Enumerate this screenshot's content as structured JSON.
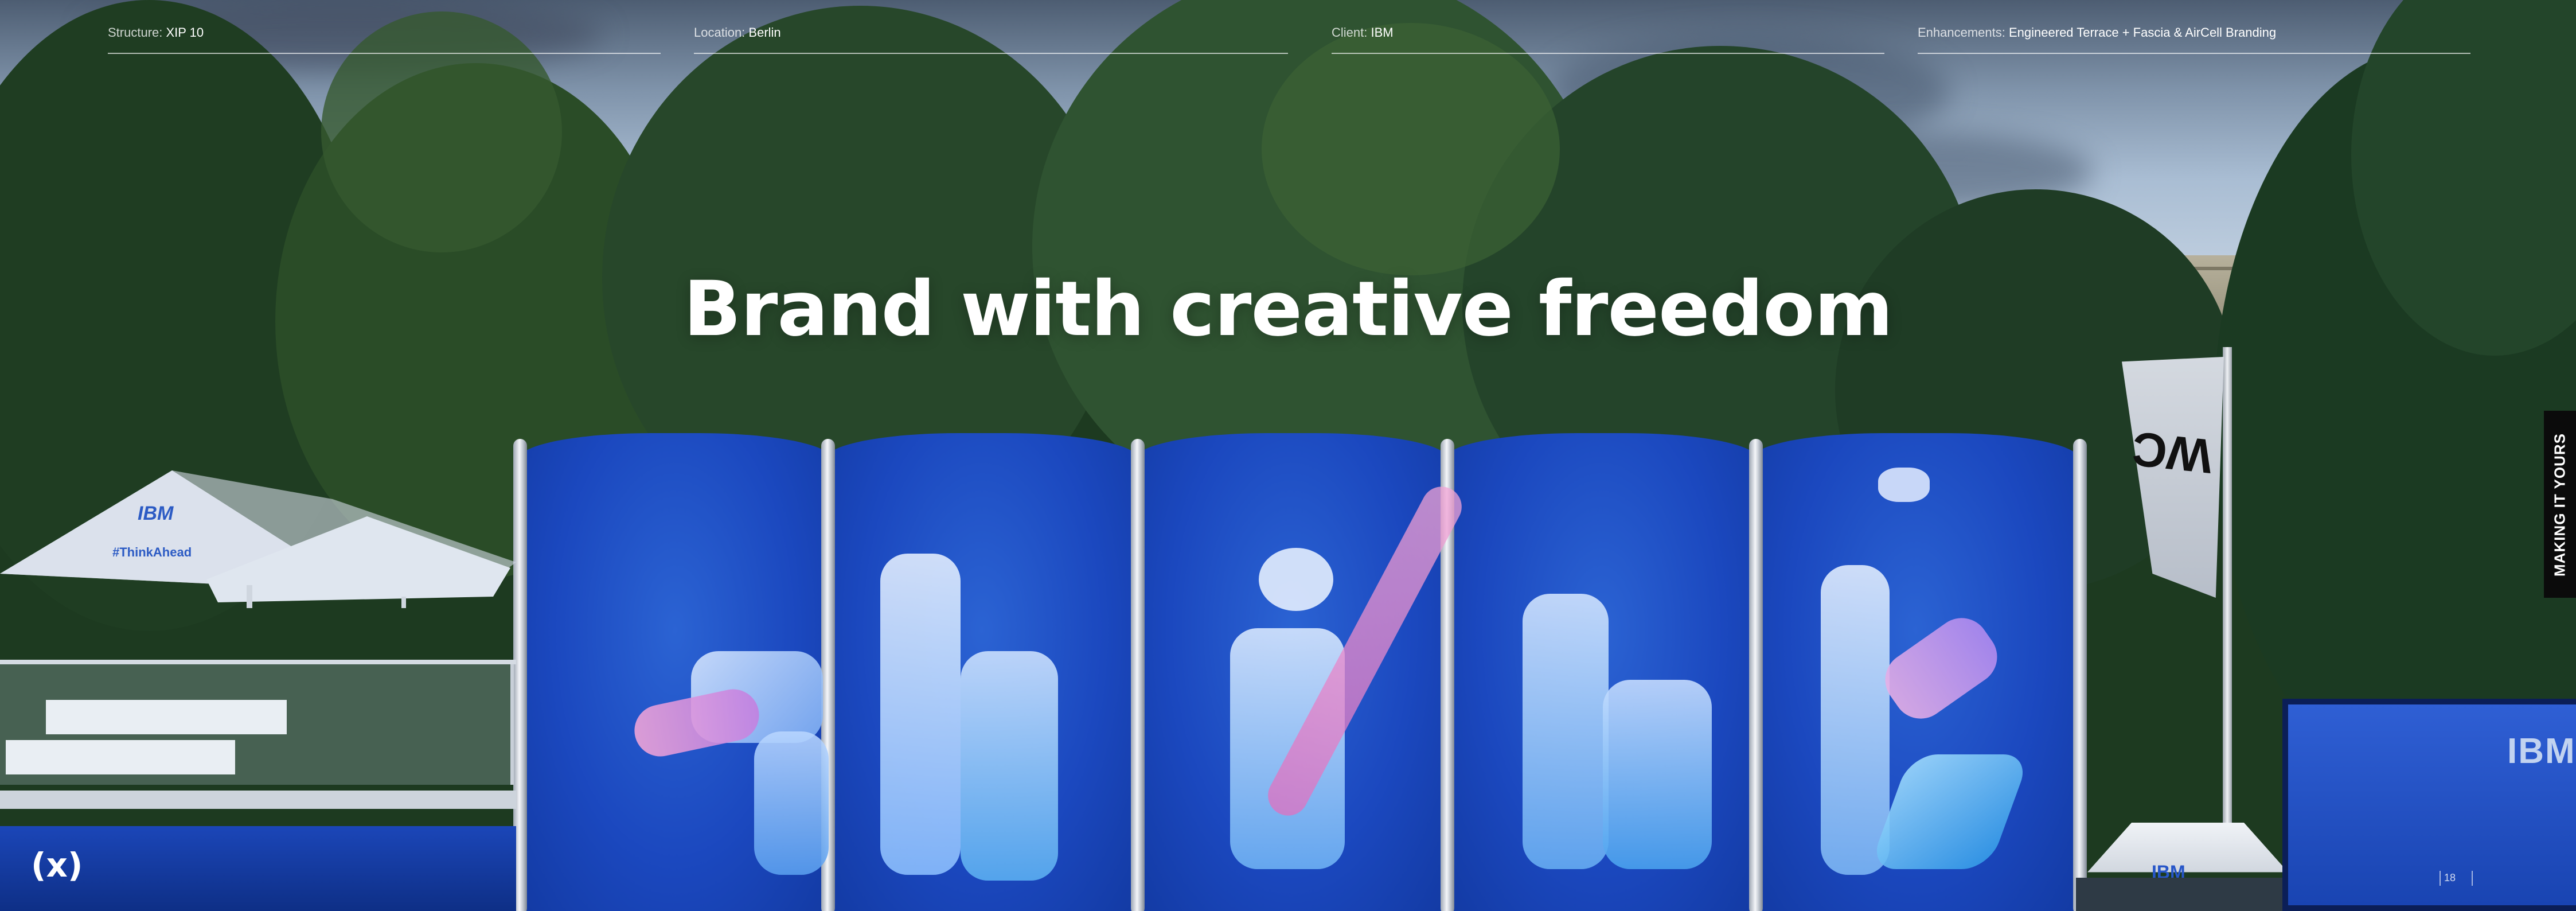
{
  "info_bar": {
    "structure": {
      "label": "Structure:",
      "value": "XIP 10"
    },
    "location": {
      "label": "Location:",
      "value": "Berlin"
    },
    "client": {
      "label": "Client:",
      "value": "IBM"
    },
    "enhancements": {
      "label": "Enhancements:",
      "value": "Engineered Terrace + Fascia & AirCell Branding"
    }
  },
  "headline": "Brand with creative freedom",
  "side_tab": "MAKING IT YOURS",
  "logo": "(x)",
  "page_number": "18",
  "photo": {
    "umbrella_brand": "IBM",
    "umbrella_hashtag": "#ThinkAhead",
    "flag_text": "WC",
    "screen_logo": "IBM",
    "tent_logo": "IBM"
  },
  "colors": {
    "overlay_text": "#ffffff",
    "ibm_blue": "#1b48bf",
    "side_tab": "#0b0b0b"
  }
}
